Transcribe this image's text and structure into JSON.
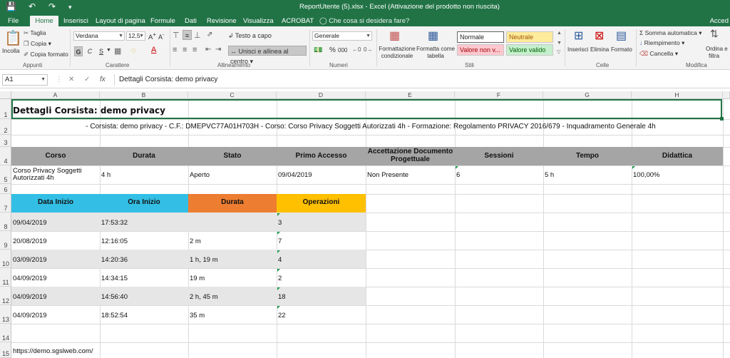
{
  "window": {
    "title": "ReportUtente (5).xlsx  -  Excel (Attivazione del prodotto non riuscita)",
    "user": "Acced"
  },
  "tabs": [
    "File",
    "Home",
    "Inserisci",
    "Layout di pagina",
    "Formule",
    "Dati",
    "Revisione",
    "Visualizza",
    "ACROBAT"
  ],
  "active_tab": "Home",
  "tell_me": "Che cosa si desidera fare?",
  "ribbon": {
    "clipboard": {
      "paste": "Incolla",
      "cut": "Taglia",
      "copy": "Copia",
      "format_painter": "Copia formato",
      "label": "Appunti"
    },
    "font": {
      "name": "Verdana",
      "size": "12,5",
      "bold": "G",
      "italic": "C",
      "underline": "S",
      "label": "Carattere"
    },
    "alignment": {
      "wrap": "Testo a capo",
      "merge": "Unisci e allinea al centro",
      "label": "Allineamento"
    },
    "number": {
      "format": "Generale",
      "percent": "%",
      "thousands": "000",
      "label": "Numeri"
    },
    "styles": {
      "conditional": "Formattazione condizionale",
      "table": "Formatta come tabella",
      "normal": "Normale",
      "neutral": "Neutrale",
      "bad": "Valore non v...",
      "good": "Valore valido",
      "label": "Stili"
    },
    "cells": {
      "insert": "Inserisci",
      "delete": "Elimina",
      "format": "Formato",
      "label": "Celle"
    },
    "editing": {
      "autosum": "Somma automatica",
      "fill": "Riempimento",
      "clear": "Cancella",
      "sort": "Ordina e",
      "sort2": "filtra",
      "label": "Modifica"
    }
  },
  "formula_bar": {
    "name_box": "A1",
    "content": "Dettagli Corsista: demo privacy"
  },
  "columns": [
    "A",
    "B",
    "C",
    "D",
    "E",
    "F",
    "G",
    "H"
  ],
  "rows": [
    "1",
    "2",
    "3",
    "4",
    "5",
    "6",
    "7",
    "8",
    "9",
    "10",
    "11",
    "12",
    "13",
    "14",
    "15"
  ],
  "sheet": {
    "title": "Dettagli Corsista: demo privacy",
    "subtitle": "- Corsista: demo privacy - C.F.: DMEPVC77A01H703H - Corso: Corso Privacy Soggetti Autorizzati 4h - Formazione: Regolamento PRIVACY 2016/679 - Inquadramento Generale 4h",
    "course_headers": [
      "Corso",
      "Durata",
      "Stato",
      "Primo Accesso",
      "Accettazione Documento Progettuale",
      "Sessioni",
      "Tempo",
      "Didattica"
    ],
    "course_row": [
      "Corso Privacy Soggetti Autorizzati 4h",
      "4 h",
      "Aperto",
      "09/04/2019",
      "Non Presente",
      "6",
      "5 h",
      "100,00%"
    ],
    "session_headers": [
      "Data Inizio",
      "Ora Inizio",
      "Durata",
      "Operazioni"
    ],
    "sessions": [
      [
        "09/04/2019",
        "17:53:32",
        "",
        "3"
      ],
      [
        "20/08/2019",
        "12:16:05",
        "2 m",
        "7"
      ],
      [
        "03/09/2019",
        "14:20:36",
        "1 h, 19 m",
        "4"
      ],
      [
        "04/09/2019",
        "14:34:15",
        "19 m",
        "2"
      ],
      [
        "04/09/2019",
        "14:56:40",
        "2 h, 45 m",
        "18"
      ],
      [
        "04/09/2019",
        "18:52:54",
        "35 m",
        "22"
      ]
    ],
    "footer_url": "https://demo.sgslweb.com/"
  },
  "colors": {
    "excel_green": "#217346",
    "header_gray": "#a5a5a5",
    "cyan": "#33bfe5",
    "orange": "#ed7d31",
    "gold": "#ffc000",
    "band": "#e6e6e6"
  }
}
